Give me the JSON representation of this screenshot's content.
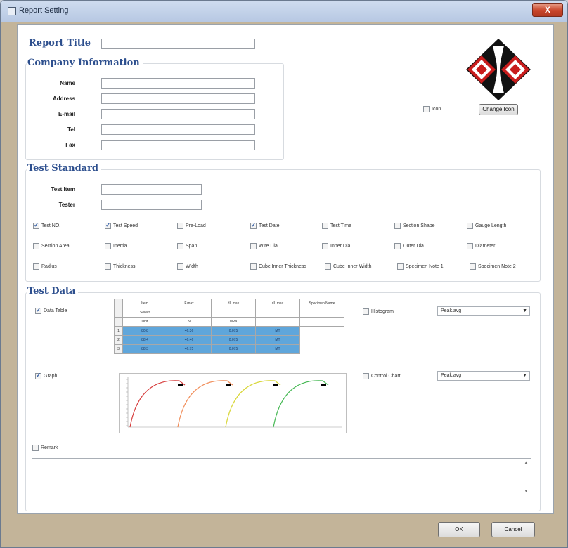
{
  "window": {
    "title": "Report Setting",
    "close_label": "X"
  },
  "report": {
    "title_label": "Report Title",
    "title_value": ""
  },
  "company": {
    "heading": "Company Information",
    "fields": [
      {
        "label": "Name",
        "value": ""
      },
      {
        "label": "Address",
        "value": ""
      },
      {
        "label": "E-mail",
        "value": ""
      },
      {
        "label": "Tel",
        "value": ""
      },
      {
        "label": "Fax",
        "value": ""
      }
    ]
  },
  "icon": {
    "checkbox_label": "Icon",
    "checked": false,
    "change_button": "Change Icon"
  },
  "test_standard": {
    "heading": "Test Standard",
    "fields": [
      {
        "label": "Test Item",
        "value": ""
      },
      {
        "label": "Tester",
        "value": ""
      }
    ],
    "checkboxes": [
      {
        "label": "Test NO.",
        "checked": true
      },
      {
        "label": "Test Speed",
        "checked": true
      },
      {
        "label": "Pre-Load",
        "checked": false
      },
      {
        "label": "Test Date",
        "checked": true
      },
      {
        "label": "Test Time",
        "checked": false
      },
      {
        "label": "Section Shape",
        "checked": false
      },
      {
        "label": "Gauge Length",
        "checked": false
      },
      {
        "label": "Section Area",
        "checked": false
      },
      {
        "label": "Inertia",
        "checked": false
      },
      {
        "label": "Span",
        "checked": false
      },
      {
        "label": "Wire Dia.",
        "checked": false
      },
      {
        "label": "Inner Dia.",
        "checked": false
      },
      {
        "label": "Outer Dia.",
        "checked": false
      },
      {
        "label": "Diameter",
        "checked": false
      },
      {
        "label": "Radius",
        "checked": false
      },
      {
        "label": "Thickness",
        "checked": false
      },
      {
        "label": "Width",
        "checked": false
      },
      {
        "label": "Cube Inner Thickness",
        "checked": false
      },
      {
        "label": "Cube Inner Width",
        "checked": false
      },
      {
        "label": "Specimen Note 1",
        "checked": false
      },
      {
        "label": "Specimen Note 2",
        "checked": false
      }
    ]
  },
  "test_data": {
    "heading": "Test Data",
    "data_table": {
      "label": "Data Table",
      "checked": true
    },
    "histogram": {
      "label": "Histogram",
      "checked": false,
      "select": "Peak.avg"
    },
    "graph": {
      "label": "Graph",
      "checked": true
    },
    "control_chart": {
      "label": "Control Chart",
      "checked": false,
      "select": "Peak.avg"
    },
    "remark": {
      "label": "Remark",
      "checked": false,
      "value": ""
    },
    "table": {
      "header": [
        "Item",
        "F.max",
        "dL.max",
        "dL.max",
        "Specimen Name"
      ],
      "subheader": [
        "Select",
        "",
        "",
        "",
        ""
      ],
      "units": [
        "Unit",
        "N",
        "MPa",
        "",
        ""
      ],
      "rows": [
        [
          "1",
          "80.8",
          "46.36",
          "0.075",
          "MT"
        ],
        [
          "2",
          "88.4",
          "46.46",
          "0.075",
          "MT"
        ],
        [
          "3",
          "88.3",
          "46.75",
          "0.075",
          "MT"
        ]
      ]
    },
    "curve_colors": [
      "#d63b3b",
      "#f08a55",
      "#d8d637",
      "#45b853"
    ]
  },
  "buttons": {
    "ok": "OK",
    "cancel": "Cancel"
  }
}
